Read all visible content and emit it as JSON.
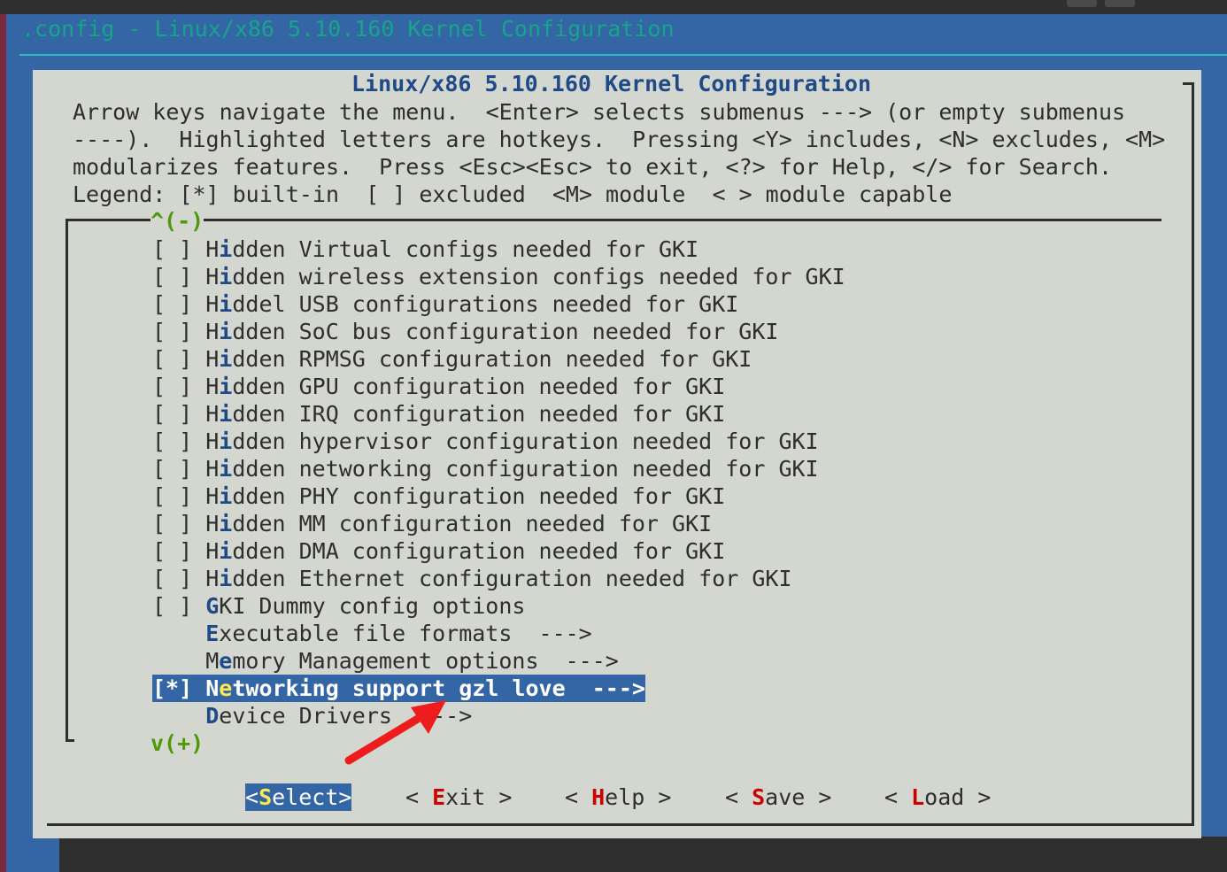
{
  "window": {
    "title": ".config - Linux/x86 5.10.160 Kernel Configuration"
  },
  "dialog": {
    "title": "Linux/x86 5.10.160 Kernel Configuration",
    "help_lines": [
      "Arrow keys navigate the menu.  <Enter> selects submenus ---> (or empty submenus",
      "----).  Highlighted letters are hotkeys.  Pressing <Y> includes, <N> excludes, <M>",
      "modularizes features.  Press <Esc><Esc> to exit, <?> for Help, </> for Search.",
      "Legend: [*] built-in  [ ] excluded  <M> module  < > module capable"
    ]
  },
  "menu": {
    "scroll_up": "^(-)",
    "scroll_down": "v(+)",
    "items": [
      {
        "state": "[ ] ",
        "pre": "H",
        "hotkey": "i",
        "rest": "dden Virtual configs needed for GKI"
      },
      {
        "state": "[ ] ",
        "pre": "H",
        "hotkey": "i",
        "rest": "dden wireless extension configs needed for GKI"
      },
      {
        "state": "[ ] ",
        "pre": "H",
        "hotkey": "i",
        "rest": "ddel USB configurations needed for GKI"
      },
      {
        "state": "[ ] ",
        "pre": "H",
        "hotkey": "i",
        "rest": "dden SoC bus configuration needed for GKI"
      },
      {
        "state": "[ ] ",
        "pre": "H",
        "hotkey": "i",
        "rest": "dden RPMSG configuration needed for GKI"
      },
      {
        "state": "[ ] ",
        "pre": "H",
        "hotkey": "i",
        "rest": "dden GPU configuration needed for GKI"
      },
      {
        "state": "[ ] ",
        "pre": "H",
        "hotkey": "i",
        "rest": "dden IRQ configuration needed for GKI"
      },
      {
        "state": "[ ] ",
        "pre": "H",
        "hotkey": "i",
        "rest": "dden hypervisor configuration needed for GKI"
      },
      {
        "state": "[ ] ",
        "pre": "H",
        "hotkey": "i",
        "rest": "dden networking configuration needed for GKI"
      },
      {
        "state": "[ ] ",
        "pre": "H",
        "hotkey": "i",
        "rest": "dden PHY configuration needed for GKI"
      },
      {
        "state": "[ ] ",
        "pre": "H",
        "hotkey": "i",
        "rest": "dden MM configuration needed for GKI"
      },
      {
        "state": "[ ] ",
        "pre": "H",
        "hotkey": "i",
        "rest": "dden DMA configuration needed for GKI"
      },
      {
        "state": "[ ] ",
        "pre": "H",
        "hotkey": "i",
        "rest": "dden Ethernet configuration needed for GKI"
      },
      {
        "state": "[ ] ",
        "pre": "",
        "hotkey": "G",
        "rest": "KI Dummy config options"
      },
      {
        "state": "    ",
        "pre": "",
        "hotkey": "E",
        "rest": "xecutable file formats  --->"
      },
      {
        "state": "    ",
        "pre": "M",
        "hotkey": "e",
        "rest": "mory Management options  --->"
      },
      {
        "state": "[*] ",
        "pre": "N",
        "hotkey": "e",
        "rest": "tworking support gzl love  --->",
        "selected": true
      },
      {
        "state": "    ",
        "pre": "",
        "hotkey": "D",
        "rest": "evice Drivers  --->"
      }
    ]
  },
  "buttons": [
    {
      "open": "<",
      "pre": "",
      "hotkey": "S",
      "rest": "elect",
      "close": ">",
      "selected": true
    },
    {
      "open": "< ",
      "pre": "",
      "hotkey": "E",
      "rest": "xit",
      "close": " >"
    },
    {
      "open": "< ",
      "pre": "",
      "hotkey": "H",
      "rest": "elp",
      "close": " >"
    },
    {
      "open": "< ",
      "pre": "",
      "hotkey": "S",
      "rest": "ave",
      "close": " >"
    },
    {
      "open": "< ",
      "pre": "",
      "hotkey": "L",
      "rest": "oad",
      "close": " >"
    }
  ],
  "colors": {
    "background": "#3465a4",
    "dialog": "#d3d7cf",
    "hotkey_menu": "#204a87",
    "hotkey_button": "#cc0000",
    "selection": "#3465a4",
    "selection_hotkey": "#fce94f",
    "scroll_indicator": "#4e9a06",
    "annotation_arrow": "#ee1c1c"
  }
}
